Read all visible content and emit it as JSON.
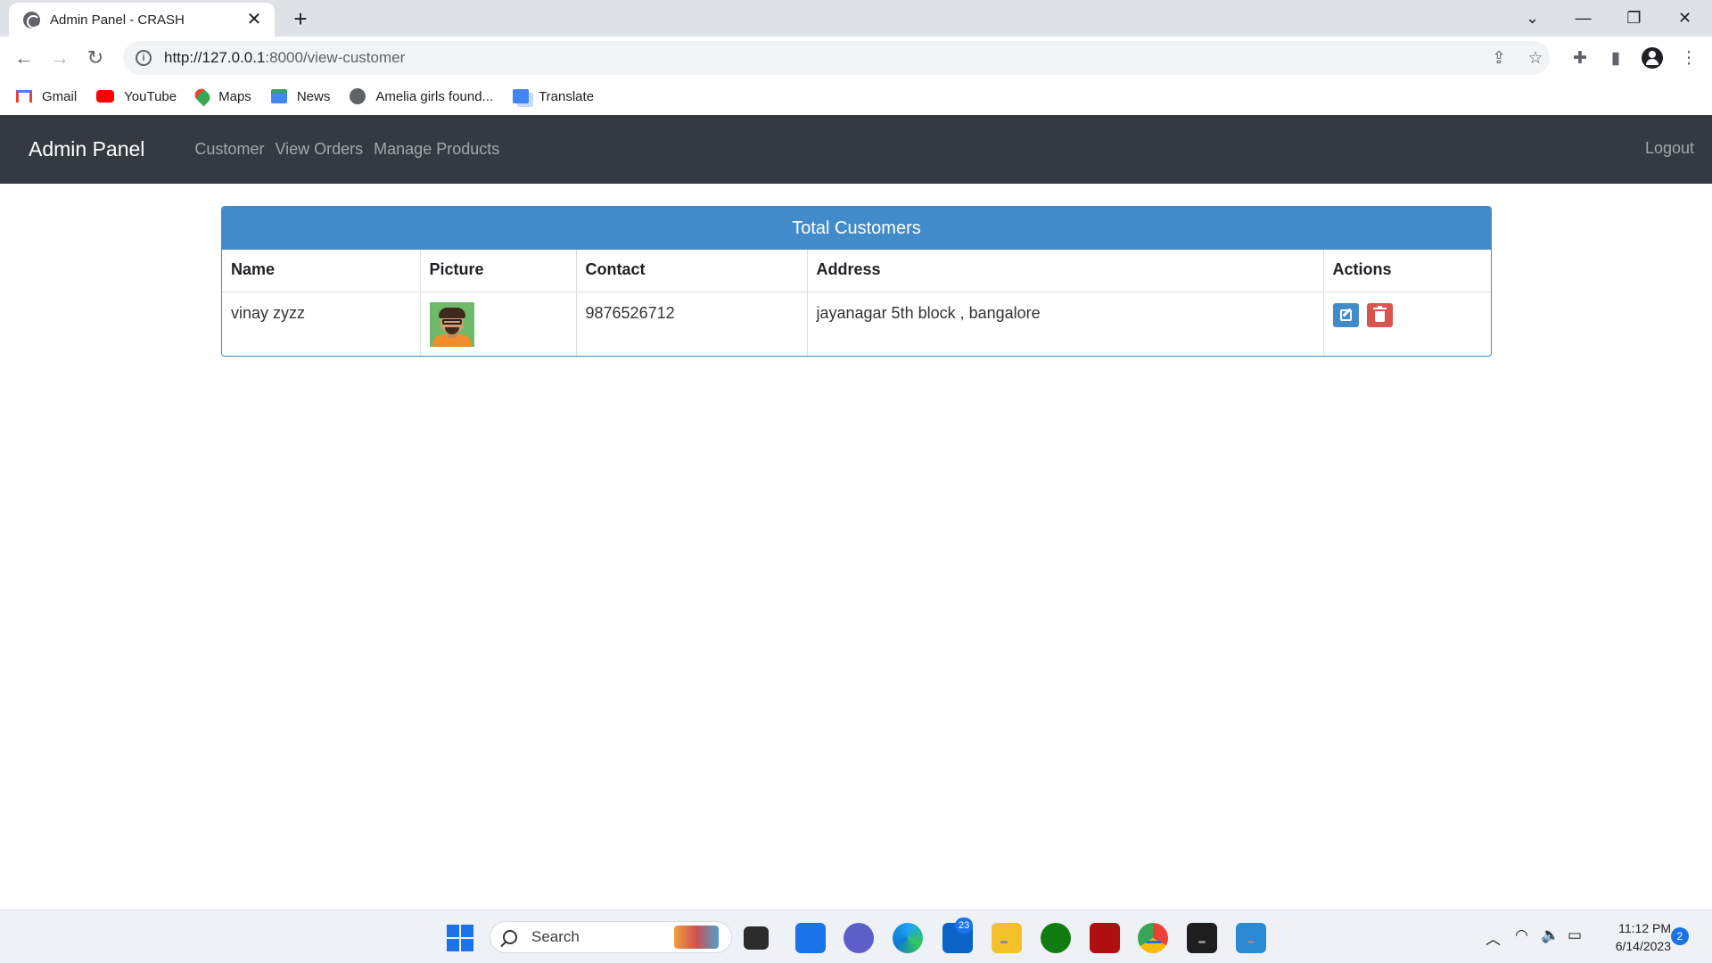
{
  "browser": {
    "tab_title": "Admin Panel - CRASH",
    "tab_close": "✕",
    "new_tab": "+",
    "url_host": "http://127.0.0.1",
    "url_rest": ":8000/view-customer",
    "bookmarks": [
      {
        "label": "Gmail",
        "icon": "gmail-icon",
        "color": "#ea4335"
      },
      {
        "label": "YouTube",
        "icon": "youtube-icon",
        "color": "#ff0000"
      },
      {
        "label": "Maps",
        "icon": "maps-icon",
        "color": "#34a853"
      },
      {
        "label": "News",
        "icon": "news-icon",
        "color": "#4285f4"
      },
      {
        "label": "Amelia girls found...",
        "icon": "globe-icon",
        "color": "#5f6368"
      },
      {
        "label": "Translate",
        "icon": "translate-icon",
        "color": "#4285f4"
      }
    ]
  },
  "nav": {
    "brand": "Admin Panel",
    "links": [
      "Customer",
      "View Orders",
      "Manage Products"
    ],
    "logout": "Logout"
  },
  "card": {
    "title": "Total Customers",
    "columns": [
      "Name",
      "Picture",
      "Contact",
      "Address",
      "Actions"
    ],
    "rows": [
      {
        "name": "vinay zyzz",
        "contact": "9876526712",
        "address": "jayanagar 5th block , bangalore"
      }
    ]
  },
  "taskbar": {
    "search_label": "Search",
    "mail_badge": "23",
    "time": "11:12 PM",
    "date": "6/14/2023",
    "notification_count": "2"
  },
  "colors": {
    "navbar": "#343a40",
    "card_header": "#428bca",
    "edit_button": "#428bca",
    "delete_button": "#d9534f"
  }
}
